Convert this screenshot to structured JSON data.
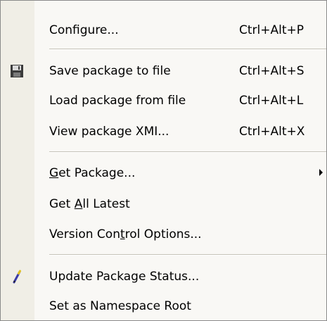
{
  "menu": {
    "configure": {
      "label": "Configure...",
      "shortcut": "Ctrl+Alt+P"
    },
    "save_package": {
      "label": "Save package to file",
      "shortcut": "Ctrl+Alt+S",
      "icon": "floppy-disk-icon"
    },
    "load_package": {
      "label": "Load package from file",
      "shortcut": "Ctrl+Alt+L"
    },
    "view_xmi": {
      "label": "View package XMI...",
      "shortcut": "Ctrl+Alt+X"
    },
    "get_package": {
      "label_pre": "",
      "label_key": "G",
      "label_post": "et Package...",
      "submenu": true
    },
    "get_all_latest": {
      "label_pre": "Get ",
      "label_key": "A",
      "label_post": "ll Latest"
    },
    "version_control": {
      "label_pre": "Version Con",
      "label_key": "t",
      "label_post": "rol Options..."
    },
    "update_status": {
      "label": "Update Package Status...",
      "icon": "pencil-icon"
    },
    "namespace_root": {
      "label": "Set as Namespace Root"
    }
  },
  "colors": {
    "menu_background": "#f9f8f5",
    "gutter_background": "#f0eee6",
    "border": "#8a8a8a",
    "separator": "#c5c2b8"
  }
}
